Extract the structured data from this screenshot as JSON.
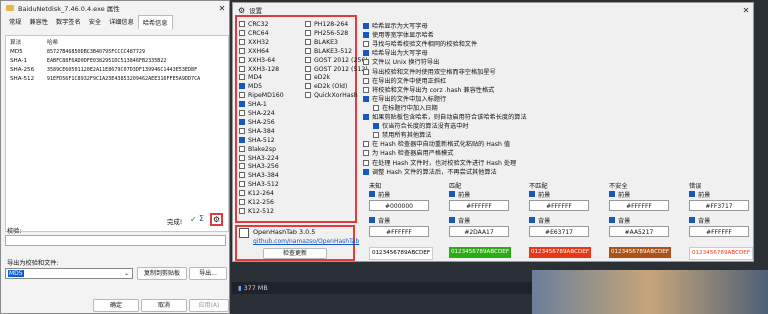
{
  "props_window": {
    "title": "BaiduNetdisk_7.46.0.4.exe 属性",
    "tabs": [
      "常规",
      "兼容性",
      "数字签名",
      "安全",
      "详细信息",
      "哈希信息"
    ],
    "table_headers": [
      "算法",
      "哈希"
    ],
    "rows": [
      {
        "alg": "MD5",
        "hash": "85727B46850DBC3B40795FCCCC487729"
      },
      {
        "alg": "SHA-1",
        "hash": "EABFC88F6AD0DFE0382951DC513846FB2335B22"
      },
      {
        "alg": "SHA-256",
        "hash": "3589CE60501120E2A11E8679C07D3DF139946C1443E53ED8F"
      },
      {
        "alg": "SHA-512",
        "hash": "91EFD56F1C8932F9C1A23E43853209462AEE316FFE5A9DD7CA"
      }
    ],
    "done_label": "完成!",
    "verify_label": "校验:",
    "export_label": "导出为校验和文件:",
    "export_value": "MD5",
    "copy_button": "复制到剪贴板",
    "export_button": "导出...",
    "ok_button": "确定",
    "cancel_button": "取消",
    "apply_button": "应用(A)"
  },
  "settings_window": {
    "title": "设置",
    "algorithms_col1": [
      {
        "name": "CRC32",
        "on": false
      },
      {
        "name": "CRC64",
        "on": false
      },
      {
        "name": "XXH32",
        "on": false
      },
      {
        "name": "XXH64",
        "on": false
      },
      {
        "name": "XXH3-64",
        "on": false
      },
      {
        "name": "XXH3-128",
        "on": false
      },
      {
        "name": "MD4",
        "on": false
      },
      {
        "name": "MD5",
        "on": true
      },
      {
        "name": "RipeMD160",
        "on": false
      },
      {
        "name": "SHA-1",
        "on": true
      },
      {
        "name": "SHA-224",
        "on": false
      },
      {
        "name": "SHA-256",
        "on": true
      },
      {
        "name": "SHA-384",
        "on": false
      },
      {
        "name": "SHA-512",
        "on": true
      },
      {
        "name": "Blake2sp",
        "on": false
      },
      {
        "name": "SHA3-224",
        "on": false
      },
      {
        "name": "SHA3-256",
        "on": false
      },
      {
        "name": "SHA3-384",
        "on": false
      },
      {
        "name": "SHA3-512",
        "on": false
      },
      {
        "name": "K12-264",
        "on": false
      },
      {
        "name": "K12-256",
        "on": false
      },
      {
        "name": "K12-512",
        "on": false
      }
    ],
    "algorithms_col2": [
      {
        "name": "PH128-264",
        "on": false
      },
      {
        "name": "PH256-528",
        "on": false
      },
      {
        "name": "BLAKE3",
        "on": false
      },
      {
        "name": "BLAKE3-512",
        "on": false
      },
      {
        "name": "GOST 2012 (256)",
        "on": false
      },
      {
        "name": "GOST 2012 (512)",
        "on": false
      },
      {
        "name": "eD2k",
        "on": false
      },
      {
        "name": "eD2k (Old)",
        "on": false
      },
      {
        "name": "QuickXorHash",
        "on": false
      }
    ],
    "options": [
      {
        "label": "哈希显示为大写字母",
        "on": true
      },
      {
        "label": "使用等宽字体显示哈希",
        "on": true
      },
      {
        "label": "寻找与哈希校验文件相同的校验和文件",
        "on": false
      },
      {
        "label": "哈希导出为大写字母",
        "on": true
      },
      {
        "label": "文件以 Unix 换行符导出",
        "on": false
      },
      {
        "label": "导出校验和文件时使用双空格而非空格加星号",
        "on": false
      },
      {
        "label": "在导出的文件中使用正斜杠",
        "on": false
      },
      {
        "label": "将校验和文件导出为 corz .hash 兼容性格式",
        "on": false
      },
      {
        "label": "在导出的文件中加入标题行",
        "on": true
      },
      {
        "label": "在标题行中加入日期",
        "on": false
      },
      {
        "label": "如果剪贴板包含哈希，则自动启用符合该哈希长度的算法",
        "on": true
      },
      {
        "label": "仅当符合长度的算法没有选中时",
        "on": true
      },
      {
        "label": "禁用所有其他算法",
        "on": false
      },
      {
        "label": "在 Hash 检查器中自动重新格式化粘贴的 Hash 值",
        "on": false
      },
      {
        "label": "为 Hash 检查器启用严格模式",
        "on": false
      },
      {
        "label": "在处理 Hash 文件时，也对校验文件进行 Hash 处理",
        "on": false
      },
      {
        "label": "调整 Hash 文件的算法后，不再尝试其他算法",
        "on": true
      }
    ],
    "color_columns": [
      {
        "head": "未知",
        "fg": "#000000",
        "bg": "#FFFFFF",
        "sample": "0123456789ABCDEF",
        "sample_fg": "#000000",
        "sample_bg": "#FFFFFF"
      },
      {
        "head": "匹配",
        "fg": "#FFFFFF",
        "bg": "#2DAA17",
        "sample": "0123456789ABCDEF",
        "sample_fg": "#FFFFFF",
        "sample_bg": "#2DAA17"
      },
      {
        "head": "不匹配",
        "fg": "#FFFFFF",
        "bg": "#E63717",
        "sample": "0123456789ABCDEF",
        "sample_fg": "#FFFFFF",
        "sample_bg": "#E63717"
      },
      {
        "head": "不安全",
        "fg": "#FFFFFF",
        "bg": "#AA5217",
        "sample": "0123456789ABCDEF",
        "sample_fg": "#FFFFFF",
        "sample_bg": "#AA5217"
      },
      {
        "head": "错误",
        "fg": "#FF3717",
        "bg": "#FFFFFF",
        "sample": "0123456789ABCDEF",
        "sample_fg": "#FF3717",
        "sample_bg": "#FFFFFF"
      }
    ],
    "fg_label": "前景",
    "bg_label": "背景",
    "app_name": "OpenHashTab 3.0.5",
    "app_link": "github.com/namazso/OpenHashTab",
    "update_button": "检查更新"
  },
  "status_text": "377 MB"
}
